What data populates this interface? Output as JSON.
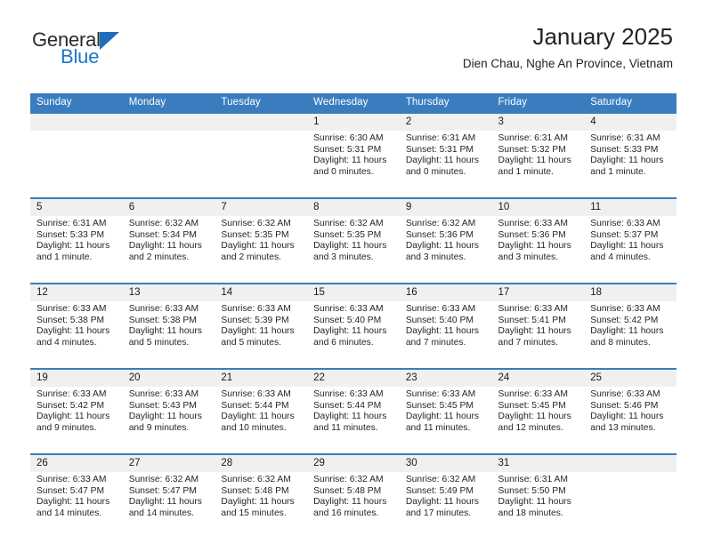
{
  "brand": {
    "line1": "General",
    "line2": "Blue",
    "triangle_color": "#1c6fba",
    "blue_text_color": "#1878c8"
  },
  "header": {
    "title": "January 2025",
    "subtitle": "Dien Chau, Nghe An Province, Vietnam"
  },
  "theme": {
    "header_band": "#3a7dbf",
    "daynum_band": "#f0f0f0",
    "cell_bg": "#ffffff",
    "text": "#262626"
  },
  "weekday_headers": [
    "Sunday",
    "Monday",
    "Tuesday",
    "Wednesday",
    "Thursday",
    "Friday",
    "Saturday"
  ],
  "weeks": [
    {
      "days": [
        {
          "num": "",
          "sunrise": "",
          "sunset": "",
          "daylight1": "",
          "daylight2": ""
        },
        {
          "num": "",
          "sunrise": "",
          "sunset": "",
          "daylight1": "",
          "daylight2": ""
        },
        {
          "num": "",
          "sunrise": "",
          "sunset": "",
          "daylight1": "",
          "daylight2": ""
        },
        {
          "num": "1",
          "sunrise": "Sunrise: 6:30 AM",
          "sunset": "Sunset: 5:31 PM",
          "daylight1": "Daylight: 11 hours",
          "daylight2": "and 0 minutes."
        },
        {
          "num": "2",
          "sunrise": "Sunrise: 6:31 AM",
          "sunset": "Sunset: 5:31 PM",
          "daylight1": "Daylight: 11 hours",
          "daylight2": "and 0 minutes."
        },
        {
          "num": "3",
          "sunrise": "Sunrise: 6:31 AM",
          "sunset": "Sunset: 5:32 PM",
          "daylight1": "Daylight: 11 hours",
          "daylight2": "and 1 minute."
        },
        {
          "num": "4",
          "sunrise": "Sunrise: 6:31 AM",
          "sunset": "Sunset: 5:33 PM",
          "daylight1": "Daylight: 11 hours",
          "daylight2": "and 1 minute."
        }
      ]
    },
    {
      "days": [
        {
          "num": "5",
          "sunrise": "Sunrise: 6:31 AM",
          "sunset": "Sunset: 5:33 PM",
          "daylight1": "Daylight: 11 hours",
          "daylight2": "and 1 minute."
        },
        {
          "num": "6",
          "sunrise": "Sunrise: 6:32 AM",
          "sunset": "Sunset: 5:34 PM",
          "daylight1": "Daylight: 11 hours",
          "daylight2": "and 2 minutes."
        },
        {
          "num": "7",
          "sunrise": "Sunrise: 6:32 AM",
          "sunset": "Sunset: 5:35 PM",
          "daylight1": "Daylight: 11 hours",
          "daylight2": "and 2 minutes."
        },
        {
          "num": "8",
          "sunrise": "Sunrise: 6:32 AM",
          "sunset": "Sunset: 5:35 PM",
          "daylight1": "Daylight: 11 hours",
          "daylight2": "and 3 minutes."
        },
        {
          "num": "9",
          "sunrise": "Sunrise: 6:32 AM",
          "sunset": "Sunset: 5:36 PM",
          "daylight1": "Daylight: 11 hours",
          "daylight2": "and 3 minutes."
        },
        {
          "num": "10",
          "sunrise": "Sunrise: 6:33 AM",
          "sunset": "Sunset: 5:36 PM",
          "daylight1": "Daylight: 11 hours",
          "daylight2": "and 3 minutes."
        },
        {
          "num": "11",
          "sunrise": "Sunrise: 6:33 AM",
          "sunset": "Sunset: 5:37 PM",
          "daylight1": "Daylight: 11 hours",
          "daylight2": "and 4 minutes."
        }
      ]
    },
    {
      "days": [
        {
          "num": "12",
          "sunrise": "Sunrise: 6:33 AM",
          "sunset": "Sunset: 5:38 PM",
          "daylight1": "Daylight: 11 hours",
          "daylight2": "and 4 minutes."
        },
        {
          "num": "13",
          "sunrise": "Sunrise: 6:33 AM",
          "sunset": "Sunset: 5:38 PM",
          "daylight1": "Daylight: 11 hours",
          "daylight2": "and 5 minutes."
        },
        {
          "num": "14",
          "sunrise": "Sunrise: 6:33 AM",
          "sunset": "Sunset: 5:39 PM",
          "daylight1": "Daylight: 11 hours",
          "daylight2": "and 5 minutes."
        },
        {
          "num": "15",
          "sunrise": "Sunrise: 6:33 AM",
          "sunset": "Sunset: 5:40 PM",
          "daylight1": "Daylight: 11 hours",
          "daylight2": "and 6 minutes."
        },
        {
          "num": "16",
          "sunrise": "Sunrise: 6:33 AM",
          "sunset": "Sunset: 5:40 PM",
          "daylight1": "Daylight: 11 hours",
          "daylight2": "and 7 minutes."
        },
        {
          "num": "17",
          "sunrise": "Sunrise: 6:33 AM",
          "sunset": "Sunset: 5:41 PM",
          "daylight1": "Daylight: 11 hours",
          "daylight2": "and 7 minutes."
        },
        {
          "num": "18",
          "sunrise": "Sunrise: 6:33 AM",
          "sunset": "Sunset: 5:42 PM",
          "daylight1": "Daylight: 11 hours",
          "daylight2": "and 8 minutes."
        }
      ]
    },
    {
      "days": [
        {
          "num": "19",
          "sunrise": "Sunrise: 6:33 AM",
          "sunset": "Sunset: 5:42 PM",
          "daylight1": "Daylight: 11 hours",
          "daylight2": "and 9 minutes."
        },
        {
          "num": "20",
          "sunrise": "Sunrise: 6:33 AM",
          "sunset": "Sunset: 5:43 PM",
          "daylight1": "Daylight: 11 hours",
          "daylight2": "and 9 minutes."
        },
        {
          "num": "21",
          "sunrise": "Sunrise: 6:33 AM",
          "sunset": "Sunset: 5:44 PM",
          "daylight1": "Daylight: 11 hours",
          "daylight2": "and 10 minutes."
        },
        {
          "num": "22",
          "sunrise": "Sunrise: 6:33 AM",
          "sunset": "Sunset: 5:44 PM",
          "daylight1": "Daylight: 11 hours",
          "daylight2": "and 11 minutes."
        },
        {
          "num": "23",
          "sunrise": "Sunrise: 6:33 AM",
          "sunset": "Sunset: 5:45 PM",
          "daylight1": "Daylight: 11 hours",
          "daylight2": "and 11 minutes."
        },
        {
          "num": "24",
          "sunrise": "Sunrise: 6:33 AM",
          "sunset": "Sunset: 5:45 PM",
          "daylight1": "Daylight: 11 hours",
          "daylight2": "and 12 minutes."
        },
        {
          "num": "25",
          "sunrise": "Sunrise: 6:33 AM",
          "sunset": "Sunset: 5:46 PM",
          "daylight1": "Daylight: 11 hours",
          "daylight2": "and 13 minutes."
        }
      ]
    },
    {
      "days": [
        {
          "num": "26",
          "sunrise": "Sunrise: 6:33 AM",
          "sunset": "Sunset: 5:47 PM",
          "daylight1": "Daylight: 11 hours",
          "daylight2": "and 14 minutes."
        },
        {
          "num": "27",
          "sunrise": "Sunrise: 6:32 AM",
          "sunset": "Sunset: 5:47 PM",
          "daylight1": "Daylight: 11 hours",
          "daylight2": "and 14 minutes."
        },
        {
          "num": "28",
          "sunrise": "Sunrise: 6:32 AM",
          "sunset": "Sunset: 5:48 PM",
          "daylight1": "Daylight: 11 hours",
          "daylight2": "and 15 minutes."
        },
        {
          "num": "29",
          "sunrise": "Sunrise: 6:32 AM",
          "sunset": "Sunset: 5:48 PM",
          "daylight1": "Daylight: 11 hours",
          "daylight2": "and 16 minutes."
        },
        {
          "num": "30",
          "sunrise": "Sunrise: 6:32 AM",
          "sunset": "Sunset: 5:49 PM",
          "daylight1": "Daylight: 11 hours",
          "daylight2": "and 17 minutes."
        },
        {
          "num": "31",
          "sunrise": "Sunrise: 6:31 AM",
          "sunset": "Sunset: 5:50 PM",
          "daylight1": "Daylight: 11 hours",
          "daylight2": "and 18 minutes."
        },
        {
          "num": "",
          "sunrise": "",
          "sunset": "",
          "daylight1": "",
          "daylight2": ""
        }
      ]
    }
  ]
}
